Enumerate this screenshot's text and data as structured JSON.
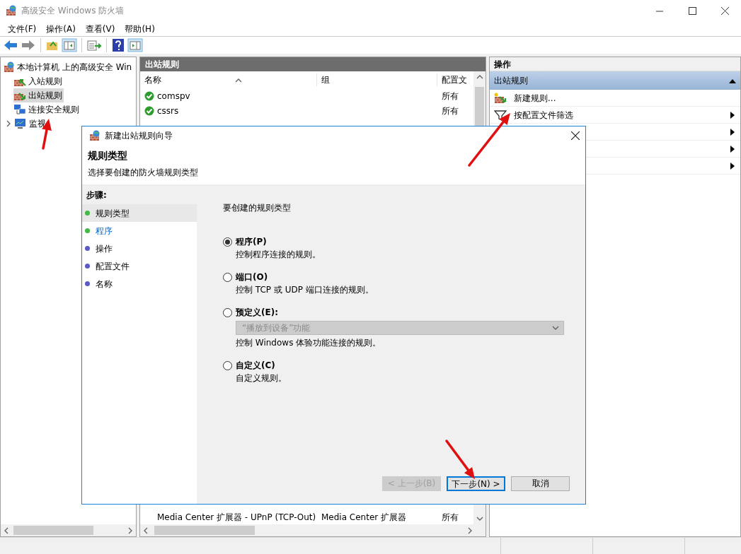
{
  "window": {
    "title": "高级安全 Windows 防火墙"
  },
  "menu": [
    "文件(F)",
    "操作(A)",
    "查看(V)",
    "帮助(H)"
  ],
  "tree": [
    {
      "label": "本地计算机 上的高级安全 Win",
      "selected": false,
      "children": [
        {
          "label": "入站规则",
          "selected": false
        },
        {
          "label": "出站规则",
          "selected": true
        },
        {
          "label": "连接安全规则",
          "selected": false
        },
        {
          "label": "监视",
          "selected": false,
          "expanded": false
        }
      ]
    }
  ],
  "rules_pane": {
    "title": "出站规则",
    "columns": [
      "名称",
      "组",
      "配置文"
    ],
    "rows": [
      {
        "name": "comspv",
        "profile": "所有",
        "enabled": true
      },
      {
        "name": "cssrs",
        "profile": "所有",
        "enabled": true
      },
      {
        "name": "Media Center 扩展器 - UPnP (TCP-Out)",
        "group": "Media Center 扩展器",
        "profile": "所有",
        "enabled": false
      }
    ]
  },
  "actions_pane": {
    "title": "操作",
    "section": {
      "title": "出站规则",
      "expanded": true
    },
    "items": [
      {
        "label": "新建规则...",
        "kind": "new-rule"
      },
      {
        "label": "按配置文件筛选",
        "kind": "filter",
        "submenu": true
      },
      {
        "kind": "hidden",
        "submenu": true
      },
      {
        "kind": "hidden",
        "submenu": true
      },
      {
        "kind": "hidden",
        "submenu": true
      }
    ]
  },
  "dialog": {
    "title": "新建出站规则向导",
    "heading": "规则类型",
    "subtitle": "选择要创建的防火墙规则类型",
    "steps_title": "步骤:",
    "steps": [
      {
        "label": "规则类型",
        "color": "#44b844",
        "selected": true,
        "hovered": false
      },
      {
        "label": "程序",
        "color": "#44b844",
        "selected": false,
        "hovered": true
      },
      {
        "label": "操作",
        "color": "#5b5bc8",
        "selected": false,
        "hovered": false
      },
      {
        "label": "配置文件",
        "color": "#5b5bc8",
        "selected": false,
        "hovered": false
      },
      {
        "label": "名称",
        "color": "#5b5bc8",
        "selected": false,
        "hovered": false
      }
    ],
    "prompt": "要创建的规则类型",
    "options": [
      {
        "label": "程序(P)",
        "description": "控制程序连接的规则。",
        "selected": true
      },
      {
        "label": "端口(O)",
        "description": "控制 TCP 或 UDP 端口连接的规则。",
        "selected": false
      },
      {
        "label": "预定义(E):",
        "description": "控制 Windows 体验功能连接的规则。",
        "selected": false,
        "dropdown": {
          "value": "“播放到设备”功能",
          "disabled": true
        }
      },
      {
        "label": "自定义(C)",
        "description": "自定义规则。",
        "selected": false
      }
    ],
    "buttons": [
      {
        "label": "< 上一步(B)",
        "disabled": true,
        "default": false
      },
      {
        "label": "下一步(N) >",
        "disabled": false,
        "default": true
      },
      {
        "label": "取消",
        "disabled": false,
        "default": false
      }
    ]
  }
}
